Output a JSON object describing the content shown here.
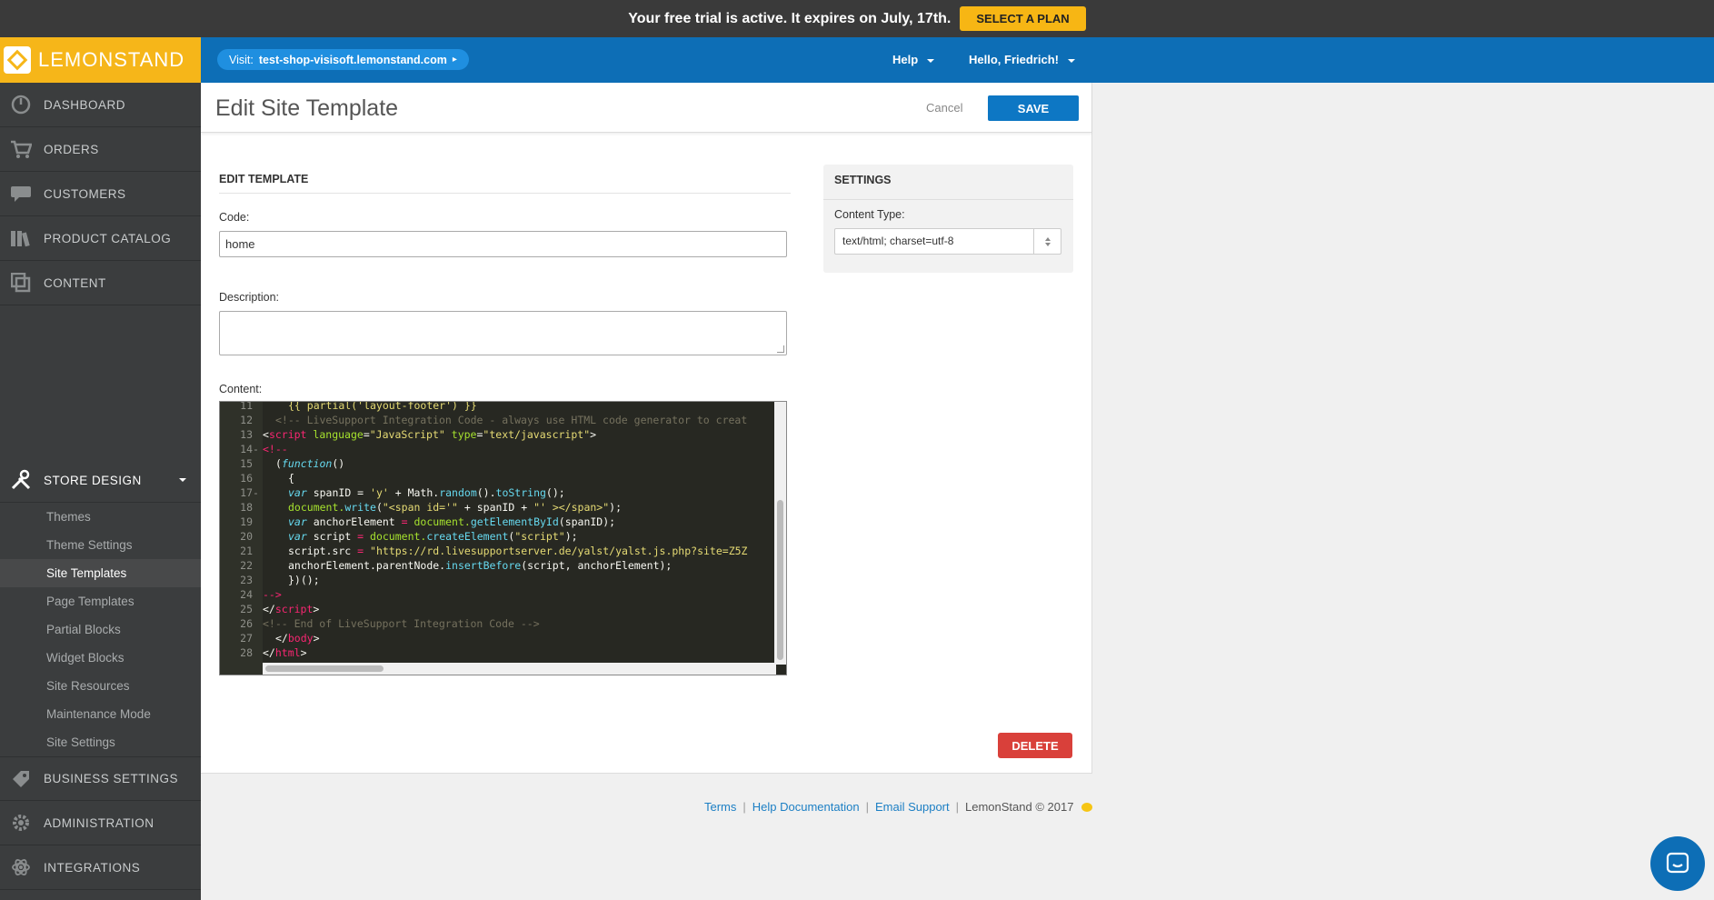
{
  "trial": {
    "message": "Your free trial is active. It expires on July, 17th.",
    "button": "SELECT A PLAN"
  },
  "brand": {
    "name": "LEMONSTAND"
  },
  "topbar": {
    "visit_prefix": "Visit:",
    "visit_url": "test-shop-visisoft.lemonstand.com",
    "help": "Help",
    "user": "Hello, Friedrich!"
  },
  "nav": {
    "dashboard": "DASHBOARD",
    "orders": "ORDERS",
    "customers": "CUSTOMERS",
    "catalog": "PRODUCT CATALOG",
    "content": "CONTENT",
    "store_design": "STORE DESIGN",
    "sub": [
      "Themes",
      "Theme Settings",
      "Site Templates",
      "Page Templates",
      "Partial Blocks",
      "Widget Blocks",
      "Site Resources",
      "Maintenance Mode",
      "Site Settings"
    ],
    "business": "BUSINESS SETTINGS",
    "admin": "ADMINISTRATION",
    "integrations": "INTEGRATIONS"
  },
  "page": {
    "title": "Edit Site Template",
    "cancel": "Cancel",
    "save": "SAVE",
    "delete": "DELETE"
  },
  "form": {
    "section_title": "EDIT TEMPLATE",
    "code_label": "Code:",
    "code_value": "home",
    "description_label": "Description:",
    "content_label": "Content:"
  },
  "editor": {
    "line_numbers": [
      "11",
      "12",
      "13",
      "14",
      "15",
      "16",
      "17",
      "18",
      "19",
      "20",
      "21",
      "22",
      "23",
      "24",
      "25",
      "26",
      "27",
      "28"
    ],
    "fold_markers": [
      "",
      "",
      "",
      "-",
      "",
      "",
      "-",
      "",
      "",
      "",
      "",
      "",
      "",
      "",
      "",
      "",
      "",
      ""
    ],
    "t": [
      "{{ partial('layout-footer') }}",
      "<!-- LiveSupport Integration Code - always use HTML code generator to creat",
      "<",
      "script",
      " ",
      "language",
      "=",
      "\"JavaScript\"",
      " ",
      "type",
      "=",
      "\"text/javascript\"",
      ">",
      "<!--",
      "(",
      "function",
      "()",
      "{",
      "var",
      " spanID = ",
      "'y'",
      " + Math.",
      "random",
      "().",
      "toString",
      "();",
      "document.",
      "write",
      "(",
      "\"<span id='\"",
      " + spanID + ",
      "\"' ></span>\"",
      ");",
      "var",
      " anchorElement ",
      "=",
      " document.",
      "getElementById",
      "(spanID);",
      "var",
      " script ",
      "=",
      " document.",
      "createElement",
      "(",
      "\"script\"",
      ");",
      "script.src ",
      "=",
      " ",
      "\"https://rd.livesupportserver.de/yalst/yalst.js.php?site=Z5Z",
      "anchorElement.parentNode.",
      "insertBefore",
      "(script, anchorElement);",
      "})();",
      "-->",
      "</",
      "script",
      ">",
      "<!-- End of LiveSupport Integration Code -->",
      "</",
      "body",
      ">",
      "</",
      "html",
      ">"
    ]
  },
  "settings": {
    "title": "SETTINGS",
    "content_type_label": "Content Type:",
    "content_type_value": "text/html; charset=utf-8"
  },
  "footer": {
    "terms": "Terms",
    "help_docs": "Help Documentation",
    "email": "Email Support",
    "copyright": "LemonStand © 2017",
    "sep": "|"
  }
}
